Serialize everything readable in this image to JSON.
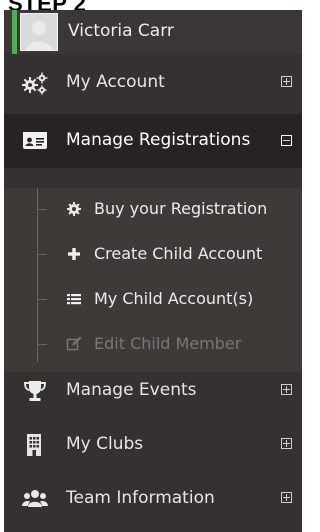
{
  "heading": "STEP 2",
  "user": {
    "name": "Victoria Carr"
  },
  "menu": {
    "items": [
      {
        "label": "My Account",
        "icon": "cogs-icon",
        "expanded": false
      },
      {
        "label": "Manage Registrations",
        "icon": "id-card-icon",
        "expanded": true
      },
      {
        "label": "Manage Events",
        "icon": "trophy-icon",
        "expanded": false
      },
      {
        "label": "My Clubs",
        "icon": "building-icon",
        "expanded": false
      },
      {
        "label": "Team Information",
        "icon": "users-icon",
        "expanded": false
      }
    ],
    "subitems": [
      {
        "label": "Buy your Registration",
        "icon": "gear-icon",
        "enabled": true
      },
      {
        "label": "Create Child Account",
        "icon": "plus-icon",
        "enabled": true
      },
      {
        "label": "My Child Account(s)",
        "icon": "list-icon",
        "enabled": true
      },
      {
        "label": "Edit Child Member",
        "icon": "edit-icon",
        "enabled": false
      }
    ]
  },
  "colors": {
    "sidebar_bg": "#353130",
    "active_bg": "#262322",
    "submenu_bg": "#3e3a38",
    "accent": "#4caf50"
  }
}
